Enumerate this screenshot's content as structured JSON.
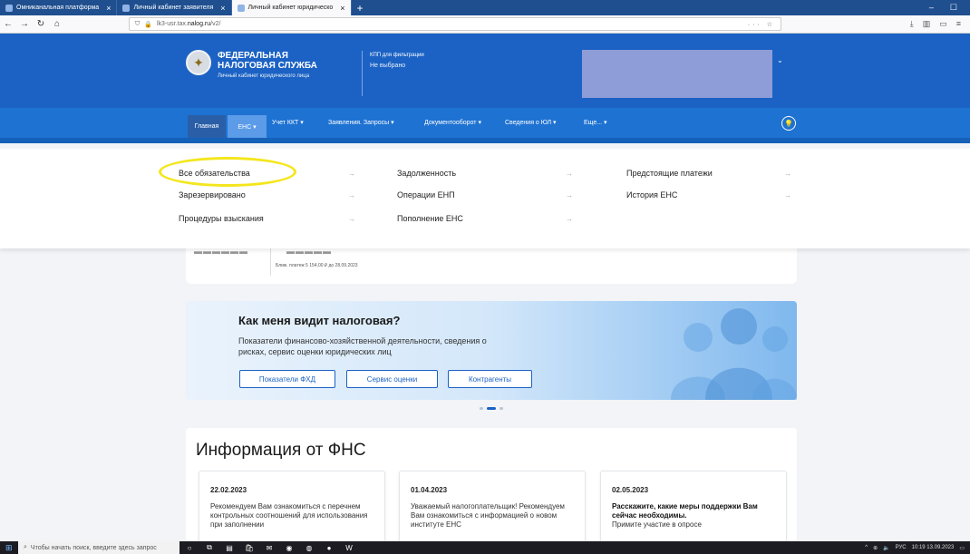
{
  "browser": {
    "tabs": [
      {
        "label": "Омниканальная платформа",
        "active": false
      },
      {
        "label": "Личный кабинет заявителя",
        "active": false
      },
      {
        "label": "Личный кабинет юридическо",
        "active": true
      }
    ],
    "new_tab": "+",
    "url": "lk3-usr.tax.nalog.ru/v2/",
    "url_host": "nalog.ru",
    "url_prefix": "lk3-usr.tax.",
    "url_suffix": "/v2/",
    "window_controls": [
      "–",
      "☐"
    ]
  },
  "header": {
    "brand_line1": "ФЕДЕРАЛЬНАЯ",
    "brand_line2": "НАЛОГОВАЯ СЛУЖБА",
    "brand_sub": "Личный кабинет юридического лица",
    "kpp_label": "КПП для фильтрации",
    "kpp_value": "Не выбрано",
    "colors": {
      "header": "#1b62c4",
      "nav": "#1e72d2"
    }
  },
  "nav": {
    "items": [
      {
        "label": "Главная"
      },
      {
        "label": "ЕНС ▾"
      },
      {
        "label": "Учет ККТ ▾"
      },
      {
        "label": "Заявления. Запросы ▾"
      },
      {
        "label": "Документооборот ▾"
      },
      {
        "label": "Сведения о ЮЛ ▾"
      },
      {
        "label": "Еще... ▾"
      }
    ]
  },
  "dropdown": {
    "items": [
      {
        "label": "Все обязательства"
      },
      {
        "label": "Зарезервировано"
      },
      {
        "label": "Процедуры взыскания"
      },
      {
        "label": "Задолженность"
      },
      {
        "label": "Операции ЕНП"
      },
      {
        "label": "Пополнение ЕНС"
      },
      {
        "label": "Предстоящие платежи"
      },
      {
        "label": "История ЕНС"
      }
    ],
    "arrow": "→"
  },
  "balance": {
    "next_payment": "Ближ. платеж 5 154,00 ₽ до 28.09.2023"
  },
  "promo": {
    "title": "Как меня видит налоговая?",
    "desc": "Показатели финансово-хозяйственной деятельности, сведения о рисках, сервис оценки юридических лиц",
    "buttons": [
      "Показатели ФХД",
      "Сервис оценки",
      "Контрагенты"
    ]
  },
  "info": {
    "title": "Информация от ФНС",
    "cards": [
      {
        "date": "22.02.2023",
        "text": "Рекомендуем Вам ознакомиться с перечнем контрольных соотношений для использования при заполнении"
      },
      {
        "date": "01.04.2023",
        "text": "Уважаемый налогоплательщик! Рекомендуем Вам ознакомиться с информацией о новом институте ЕНС"
      },
      {
        "date": "02.05.2023",
        "bold": "Расскажите, какие меры поддержки Вам сейчас необходимы.",
        "text": "Примите участие в опросе"
      }
    ]
  },
  "taskbar": {
    "search_placeholder": "Чтобы начать поиск, введите здесь запрос",
    "lang": "РУС",
    "time": "10:19",
    "date": "13.09.2023"
  }
}
